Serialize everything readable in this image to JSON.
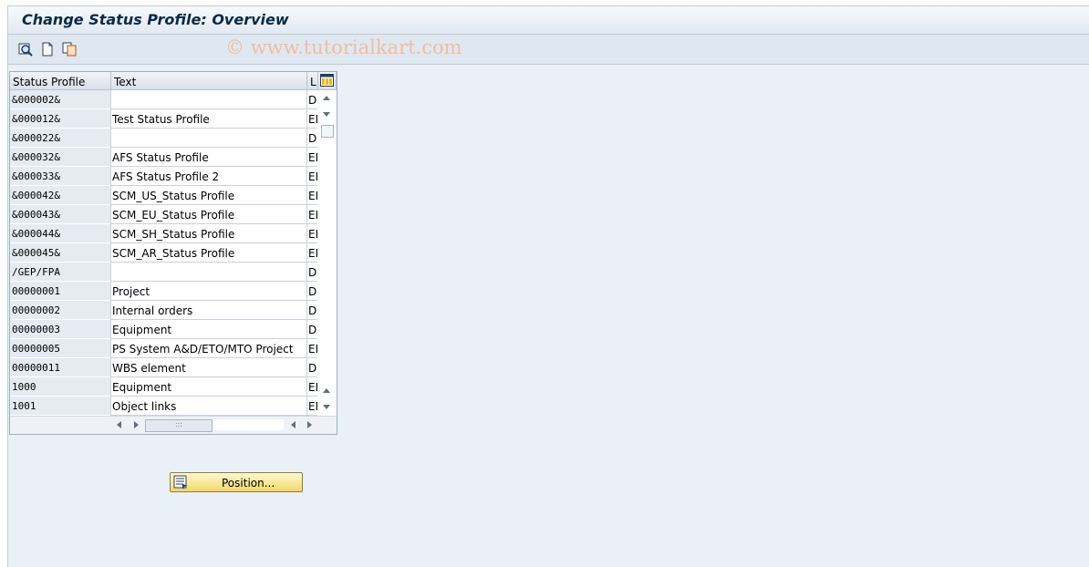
{
  "title": "Change Status Profile: Overview",
  "watermark": "© www.tutorialkart.com",
  "toolbar": {
    "icons": [
      "details-icon",
      "new-entries-icon",
      "copy-as-icon"
    ]
  },
  "table": {
    "columns": [
      "Status Profile",
      "Text",
      "L"
    ],
    "rows": [
      {
        "profile": "&000002&",
        "text": "",
        "lang": "DE"
      },
      {
        "profile": "&000012&",
        "text": "Test Status Profile",
        "lang": "EN"
      },
      {
        "profile": "&000022&",
        "text": "",
        "lang": "DE"
      },
      {
        "profile": "&000032&",
        "text": "AFS Status Profile",
        "lang": "EN"
      },
      {
        "profile": "&000033&",
        "text": "AFS Status Profile 2",
        "lang": "EN"
      },
      {
        "profile": "&000042&",
        "text": "SCM_US_Status Profile",
        "lang": "EN"
      },
      {
        "profile": "&000043&",
        "text": "SCM_EU_Status Profile",
        "lang": "EN"
      },
      {
        "profile": "&000044&",
        "text": "SCM_SH_Status Profile",
        "lang": "EN"
      },
      {
        "profile": "&000045&",
        "text": "SCM_AR_Status Profile",
        "lang": "EN"
      },
      {
        "profile": "/GEP/FPA",
        "text": "",
        "lang": "DE"
      },
      {
        "profile": "00000001",
        "text": "Project",
        "lang": "DE"
      },
      {
        "profile": "00000002",
        "text": "Internal orders",
        "lang": "DE"
      },
      {
        "profile": "00000003",
        "text": "Equipment",
        "lang": "DE"
      },
      {
        "profile": "00000005",
        "text": "PS System A&D/ETO/MTO Project",
        "lang": "EN"
      },
      {
        "profile": "00000011",
        "text": "WBS element",
        "lang": "DE"
      },
      {
        "profile": "1000",
        "text": "Equipment",
        "lang": "EN"
      },
      {
        "profile": "1001",
        "text": "Object links",
        "lang": "EN"
      }
    ]
  },
  "position_button": {
    "label": "Position..."
  }
}
